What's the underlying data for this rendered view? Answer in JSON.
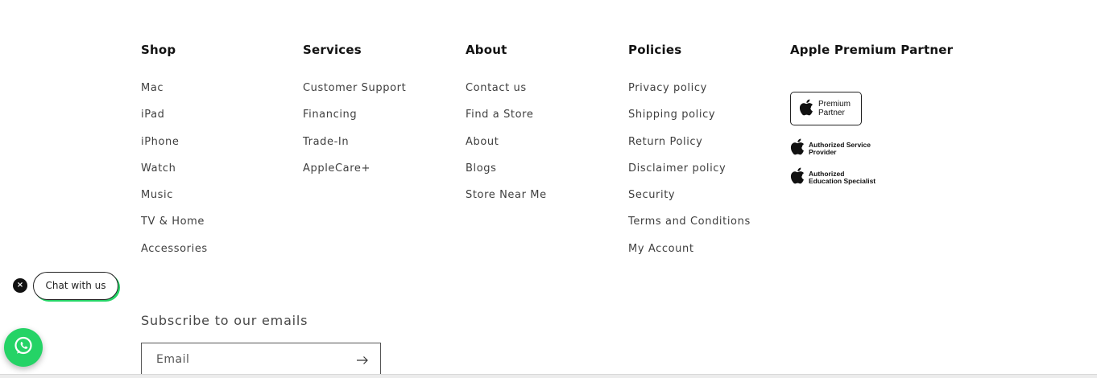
{
  "footer": {
    "columns": [
      {
        "heading": "Shop",
        "links": [
          "Mac",
          "iPad",
          "iPhone",
          "Watch",
          "Music",
          "TV & Home",
          "Accessories"
        ]
      },
      {
        "heading": "Services",
        "links": [
          "Customer Support",
          "Financing",
          "Trade-In",
          "AppleCare+"
        ]
      },
      {
        "heading": "About",
        "links": [
          "Contact us",
          "Find a Store",
          "About",
          "Blogs",
          "Store Near Me"
        ]
      },
      {
        "heading": "Policies",
        "links": [
          "Privacy policy",
          "Shipping policy",
          "Return Policy",
          "Disclaimer policy",
          "Security",
          "Terms and Conditions",
          "My Account"
        ]
      }
    ],
    "partner": {
      "heading": "Apple Premium Partner",
      "badges": [
        {
          "line1": "Premium",
          "line2": "Partner"
        },
        {
          "line1": "Authorized Service",
          "line2": "Provider"
        },
        {
          "line1": "Authorized",
          "line2": "Education Specialist"
        }
      ]
    },
    "subscribe": {
      "title": "Subscribe to our emails",
      "placeholder": "Email"
    }
  },
  "chat": {
    "label": "Chat with us",
    "close": "×"
  },
  "colors": {
    "whatsapp": "#25d366"
  }
}
